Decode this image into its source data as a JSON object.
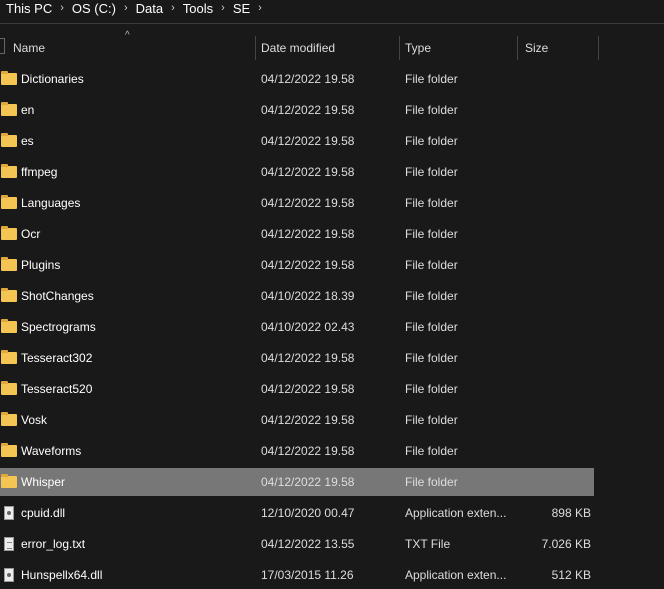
{
  "breadcrumb": [
    "This PC",
    "OS (C:)",
    "Data",
    "Tools",
    "SE"
  ],
  "columns": {
    "name": "Name",
    "date": "Date modified",
    "type": "Type",
    "size": "Size"
  },
  "rows": [
    {
      "name": "Dictionaries",
      "date": "04/12/2022 19.58",
      "type": "File folder",
      "size": "",
      "icon": "folder"
    },
    {
      "name": "en",
      "date": "04/12/2022 19.58",
      "type": "File folder",
      "size": "",
      "icon": "folder"
    },
    {
      "name": "es",
      "date": "04/12/2022 19.58",
      "type": "File folder",
      "size": "",
      "icon": "folder"
    },
    {
      "name": "ffmpeg",
      "date": "04/12/2022 19.58",
      "type": "File folder",
      "size": "",
      "icon": "folder"
    },
    {
      "name": "Languages",
      "date": "04/12/2022 19.58",
      "type": "File folder",
      "size": "",
      "icon": "folder"
    },
    {
      "name": "Ocr",
      "date": "04/12/2022 19.58",
      "type": "File folder",
      "size": "",
      "icon": "folder"
    },
    {
      "name": "Plugins",
      "date": "04/12/2022 19.58",
      "type": "File folder",
      "size": "",
      "icon": "folder"
    },
    {
      "name": "ShotChanges",
      "date": "04/10/2022 18.39",
      "type": "File folder",
      "size": "",
      "icon": "folder"
    },
    {
      "name": "Spectrograms",
      "date": "04/10/2022 02.43",
      "type": "File folder",
      "size": "",
      "icon": "folder"
    },
    {
      "name": "Tesseract302",
      "date": "04/12/2022 19.58",
      "type": "File folder",
      "size": "",
      "icon": "folder"
    },
    {
      "name": "Tesseract520",
      "date": "04/12/2022 19.58",
      "type": "File folder",
      "size": "",
      "icon": "folder"
    },
    {
      "name": "Vosk",
      "date": "04/12/2022 19.58",
      "type": "File folder",
      "size": "",
      "icon": "folder"
    },
    {
      "name": "Waveforms",
      "date": "04/12/2022 19.58",
      "type": "File folder",
      "size": "",
      "icon": "folder"
    },
    {
      "name": "Whisper",
      "date": "04/12/2022 19.58",
      "type": "File folder",
      "size": "",
      "icon": "folder",
      "selected": true
    },
    {
      "name": "cpuid.dll",
      "date": "12/10/2020 00.47",
      "type": "Application exten...",
      "size": "898 KB",
      "icon": "dll"
    },
    {
      "name": "error_log.txt",
      "date": "04/12/2022 13.55",
      "type": "TXT File",
      "size": "7.026 KB",
      "icon": "txt"
    },
    {
      "name": "Hunspellx64.dll",
      "date": "17/03/2015 11.26",
      "type": "Application exten...",
      "size": "512 KB",
      "icon": "dll"
    }
  ]
}
